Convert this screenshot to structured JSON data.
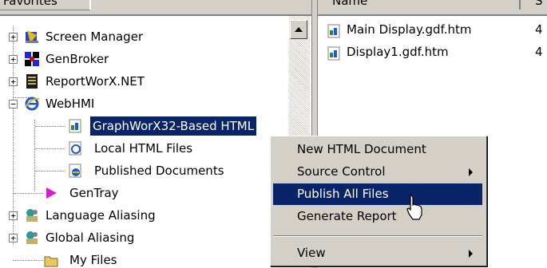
{
  "left_pane": {
    "tab_label": "Favorites"
  },
  "right_pane": {
    "col_name": "Name",
    "col_size": "S"
  },
  "tree": {
    "screen_manager": "Screen Manager",
    "genbroker": "GenBroker",
    "reportworx": "ReportWorX.NET",
    "webhmi": "WebHMI",
    "graphworx": "GraphWorX32-Based HTML",
    "local_html": "Local HTML Files",
    "published": "Published Documents",
    "gentray": "GenTray",
    "language_aliasing": "Language Aliasing",
    "global_aliasing": "Global Aliasing",
    "my_files": "My Files"
  },
  "files": [
    {
      "name": "Main Display.gdf.htm",
      "size": "4"
    },
    {
      "name": "Display1.gdf.htm",
      "size": "4"
    }
  ],
  "context_menu": {
    "new_html": "New HTML Document",
    "source_control": "Source Control",
    "publish_all": "Publish All Files",
    "generate_report": "Generate Report",
    "view": "View"
  },
  "colors": {
    "selection": "#0a246a",
    "face": "#d4d0c8"
  }
}
